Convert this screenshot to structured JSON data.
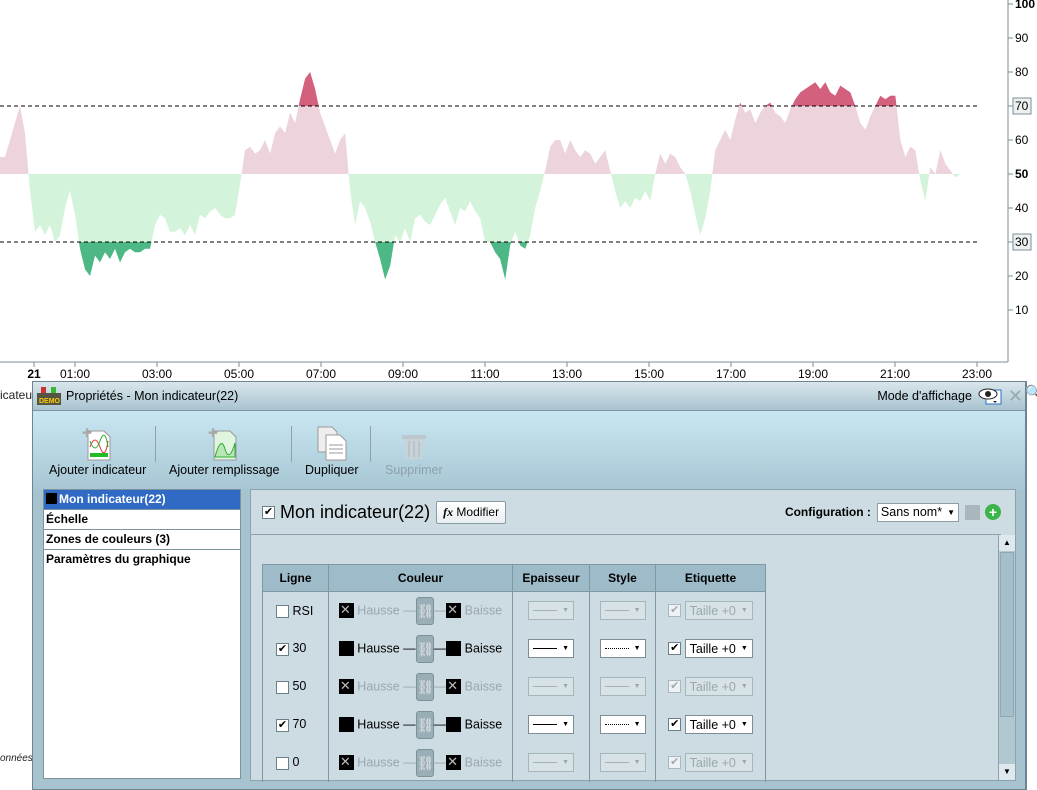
{
  "chart_data": {
    "type": "area",
    "title": "RSI",
    "y_ticks": [
      10,
      20,
      30,
      40,
      50,
      60,
      70,
      80,
      90,
      100
    ],
    "ylim": [
      0,
      100
    ],
    "x_ticks": [
      "21",
      "01:00",
      "03:00",
      "05:00",
      "07:00",
      "09:00",
      "11:00",
      "13:00",
      "15:00",
      "17:00",
      "19:00",
      "21:00",
      "23:00"
    ],
    "x_tick_hours": [
      0,
      1,
      3,
      5,
      7,
      9,
      11,
      13,
      15,
      17,
      19,
      21,
      23
    ],
    "reference_lines": [
      30,
      50,
      70
    ],
    "highlighted_labels": [
      "70",
      "30"
    ],
    "start_hour": -0.83,
    "step_hours": 0.122,
    "values": [
      55,
      55,
      60,
      65,
      70,
      62,
      45,
      33,
      35,
      32,
      35,
      30,
      32,
      40,
      45,
      38,
      28,
      22,
      20,
      26,
      24,
      27,
      25,
      28,
      24,
      27,
      28,
      27,
      27,
      28,
      28,
      35,
      38,
      37,
      33,
      33,
      34,
      32,
      35,
      32,
      38,
      37,
      39,
      40,
      38,
      37,
      37,
      38,
      47,
      57,
      58,
      56,
      57,
      60,
      56,
      62,
      64,
      62,
      68,
      65,
      72,
      78,
      80,
      75,
      68,
      64,
      60,
      56,
      60,
      62,
      45,
      35,
      42,
      40,
      36,
      30,
      25,
      19,
      23,
      32,
      30,
      34,
      30,
      37,
      38,
      36,
      35,
      38,
      41,
      43,
      39,
      35,
      40,
      39,
      42,
      39,
      37,
      30,
      30,
      27,
      25,
      19,
      29,
      33,
      29,
      28,
      32,
      40,
      45,
      51,
      58,
      60,
      60,
      56,
      60,
      57,
      55,
      57,
      56,
      53,
      55,
      57,
      51,
      45,
      40,
      42,
      40,
      43,
      42,
      45,
      42,
      50,
      56,
      53,
      56,
      55,
      52,
      50,
      45,
      38,
      32,
      37,
      45,
      57,
      60,
      63,
      60,
      66,
      71,
      68,
      69,
      65,
      68,
      70,
      71,
      68,
      67,
      65,
      69,
      72,
      74,
      75,
      76,
      77,
      75,
      77,
      74,
      73,
      76,
      75,
      74,
      70,
      65,
      63,
      67,
      70,
      73,
      72,
      73,
      73,
      60,
      55,
      58,
      57,
      48,
      42,
      52,
      50,
      57,
      53,
      51,
      49,
      50
    ],
    "colors": {
      "above": "#ecd3dc",
      "above_zone": "#d3607d",
      "below": "#d3f4da",
      "below_zone": "#4db885"
    }
  },
  "background": {
    "left_label": "icateur",
    "left_label2": "onnées"
  },
  "dialog": {
    "title": "Propriétés - Mon indicateur(22)",
    "mode_label": "Mode d'affichage",
    "toolbar": {
      "add_indicator": "Ajouter indicateur",
      "add_fill": "Ajouter remplissage",
      "duplicate": "Dupliquer",
      "delete": "Supprimer"
    },
    "nav": [
      "Mon indicateur(22)",
      "Échelle",
      "Zones de couleurs (3)",
      "Paramètres du graphique"
    ],
    "panel": {
      "indicator_name": "Mon indicateur(22)",
      "modify": "Modifier",
      "config_label": "Configuration :",
      "config_value": "Sans nom*"
    },
    "table": {
      "headers": [
        "Ligne",
        "Couleur",
        "Epaisseur",
        "Style",
        "Etiquette"
      ],
      "rows": [
        {
          "line": "RSI",
          "checked": false,
          "up": "Hausse",
          "down": "Baisse",
          "style": "solid",
          "label": "Taille +0"
        },
        {
          "line": "30",
          "checked": true,
          "up": "Hausse",
          "down": "Baisse",
          "style": "dotted",
          "label": "Taille +0"
        },
        {
          "line": "50",
          "checked": false,
          "up": "Hausse",
          "down": "Baisse",
          "style": "solid",
          "label": "Taille +0"
        },
        {
          "line": "70",
          "checked": true,
          "up": "Hausse",
          "down": "Baisse",
          "style": "dotted",
          "label": "Taille +0"
        },
        {
          "line": "0",
          "checked": false,
          "up": "Hausse",
          "down": "Baisse",
          "style": "solid",
          "label": "Taille +0"
        }
      ]
    }
  }
}
